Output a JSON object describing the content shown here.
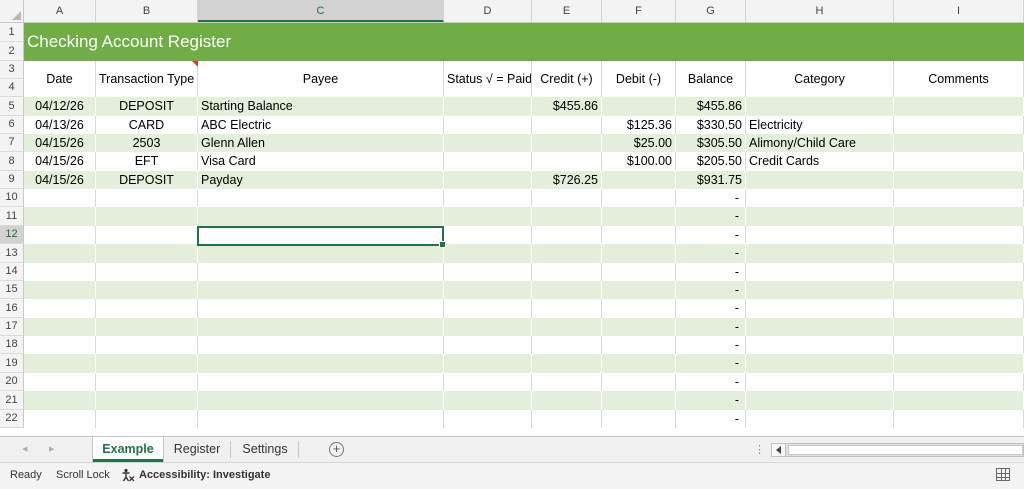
{
  "columns": [
    "A",
    "B",
    "C",
    "D",
    "E",
    "F",
    "G",
    "H",
    "I"
  ],
  "row_numbers": [
    "1",
    "2",
    "3",
    "4",
    "5",
    "6",
    "7",
    "8",
    "9",
    "10",
    "11",
    "12",
    "13",
    "14",
    "15",
    "16",
    "17",
    "18",
    "19",
    "20",
    "21",
    "22"
  ],
  "title": "Checking Account Register",
  "headers": [
    "Date",
    "Transaction Type",
    "Payee",
    "Status √ = Paid",
    "Credit (+)",
    "Debit (-)",
    "Balance",
    "Category",
    "Comments"
  ],
  "rows": [
    [
      "04/12/26",
      "DEPOSIT",
      "Starting Balance",
      "",
      "$455.86",
      "",
      "$455.86",
      "",
      ""
    ],
    [
      "04/13/26",
      "CARD",
      "ABC Electric",
      "",
      "",
      "$125.36",
      "$330.50",
      "Electricity",
      ""
    ],
    [
      "04/15/26",
      "2503",
      "Glenn Allen",
      "",
      "",
      "$25.00",
      "$305.50",
      "Alimony/Child Care",
      ""
    ],
    [
      "04/15/26",
      "EFT",
      "Visa Card",
      "",
      "",
      "$100.00",
      "$205.50",
      "Credit Cards",
      ""
    ],
    [
      "04/15/26",
      "DEPOSIT",
      "Payday",
      "",
      "$726.25",
      "",
      "$931.75",
      "",
      ""
    ],
    [
      "",
      "",
      "",
      "",
      "",
      "",
      "-",
      "",
      ""
    ],
    [
      "",
      "",
      "",
      "",
      "",
      "",
      "-",
      "",
      ""
    ],
    [
      "",
      "",
      "",
      "",
      "",
      "",
      "-",
      "",
      ""
    ],
    [
      "",
      "",
      "",
      "",
      "",
      "",
      "-",
      "",
      ""
    ],
    [
      "",
      "",
      "",
      "",
      "",
      "",
      "-",
      "",
      ""
    ],
    [
      "",
      "",
      "",
      "",
      "",
      "",
      "-",
      "",
      ""
    ],
    [
      "",
      "",
      "",
      "",
      "",
      "",
      "-",
      "",
      ""
    ],
    [
      "",
      "",
      "",
      "",
      "",
      "",
      "-",
      "",
      ""
    ],
    [
      "",
      "",
      "",
      "",
      "",
      "",
      "-",
      "",
      ""
    ],
    [
      "",
      "",
      "",
      "",
      "",
      "",
      "-",
      "",
      ""
    ],
    [
      "",
      "",
      "",
      "",
      "",
      "",
      "-",
      "",
      ""
    ],
    [
      "",
      "",
      "",
      "",
      "",
      "",
      "-",
      "",
      ""
    ],
    [
      "",
      "",
      "",
      "",
      "",
      "",
      "-",
      "",
      ""
    ]
  ],
  "tabs": [
    "Example",
    "Register",
    "Settings"
  ],
  "active_tab": "Example",
  "add_sheet_label": "+",
  "status": {
    "ready": "Ready",
    "scroll_lock": "Scroll Lock",
    "accessibility": "Accessibility: Investigate"
  },
  "nav": {
    "prev": "◂",
    "next": "▸"
  },
  "icons": {
    "accessibility": "accessibility-icon",
    "normal_view": "normal-view-icon",
    "add_sheet": "add-sheet-icon"
  },
  "colors": {
    "title_bar": "#70ad47",
    "band": "#e3efda",
    "accent": "#217346"
  },
  "selected_cell": "C12"
}
